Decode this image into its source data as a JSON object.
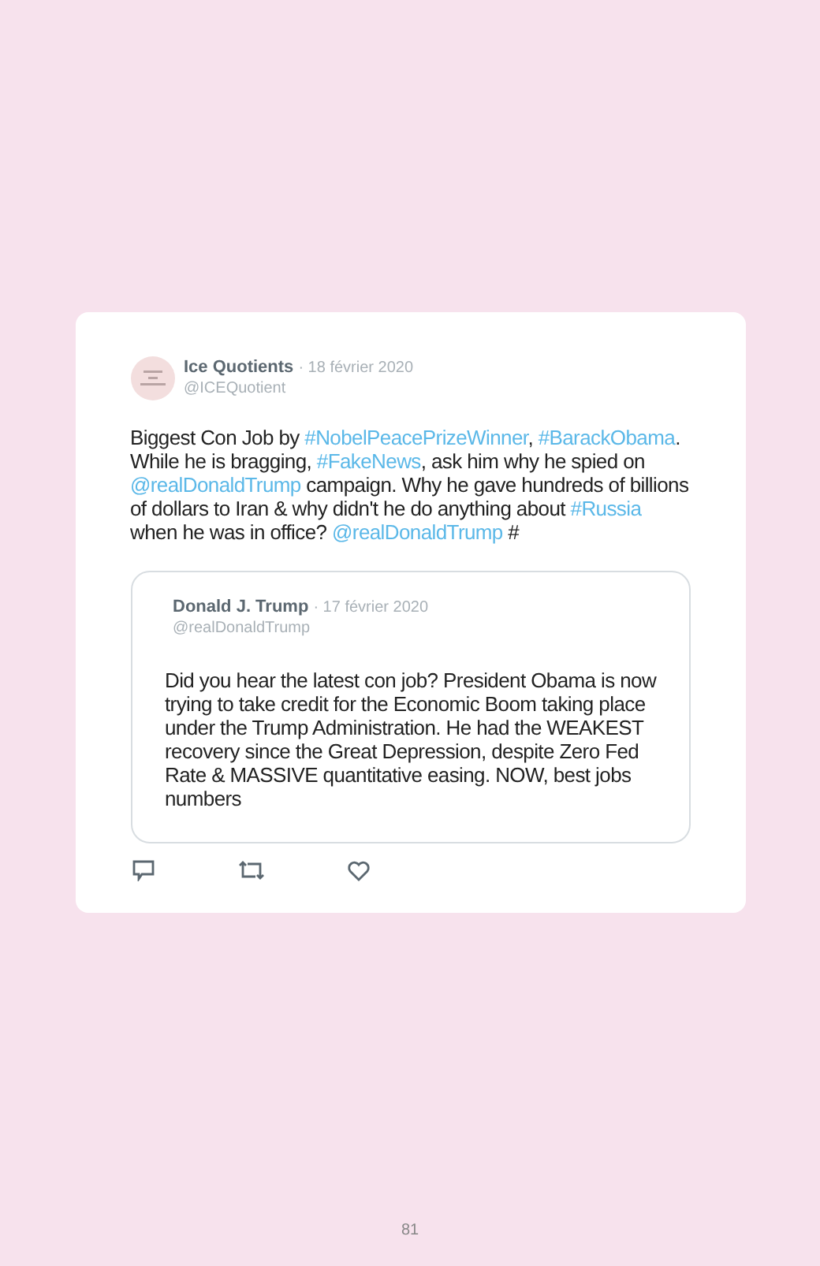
{
  "tweet": {
    "name": "Ice Quotients",
    "date": "· 18 février 2020",
    "handle": "@ICEQuotient",
    "text": [
      {
        "kind": "text",
        "t": "Biggest Con Job by "
      },
      {
        "kind": "link",
        "t": "#NobelPeacePrizeWinner"
      },
      {
        "kind": "text",
        "t": ", "
      },
      {
        "kind": "link",
        "t": "#BarackObama"
      },
      {
        "kind": "text",
        "t": ". While he is bragging, "
      },
      {
        "kind": "link",
        "t": "#FakeNews"
      },
      {
        "kind": "text",
        "t": ", ask him why he spied on "
      },
      {
        "kind": "link",
        "t": "@realDonaldTrump"
      },
      {
        "kind": "text",
        "t": " campaign. Why he gave hundreds of billions of dollars to Iran & why didn't he do anything about "
      },
      {
        "kind": "link",
        "t": "#Russia"
      },
      {
        "kind": "text",
        "t": " when he was in office? "
      },
      {
        "kind": "link",
        "t": "@realDonaldTrump"
      },
      {
        "kind": "text",
        "t": " #"
      }
    ],
    "quote": {
      "name": "Donald J. Trump",
      "date": "· 17 février 2020",
      "handle": "@realDonaldTrump",
      "text": "Did you hear the latest con job? President Obama is now trying to take credit for the Economic Boom taking place under the Trump Administration. He had the WEAKEST recovery since the Great Depression, despite Zero Fed Rate & MASSIVE quantitative easing. NOW, best jobs numbers"
    }
  },
  "page_number": "81"
}
